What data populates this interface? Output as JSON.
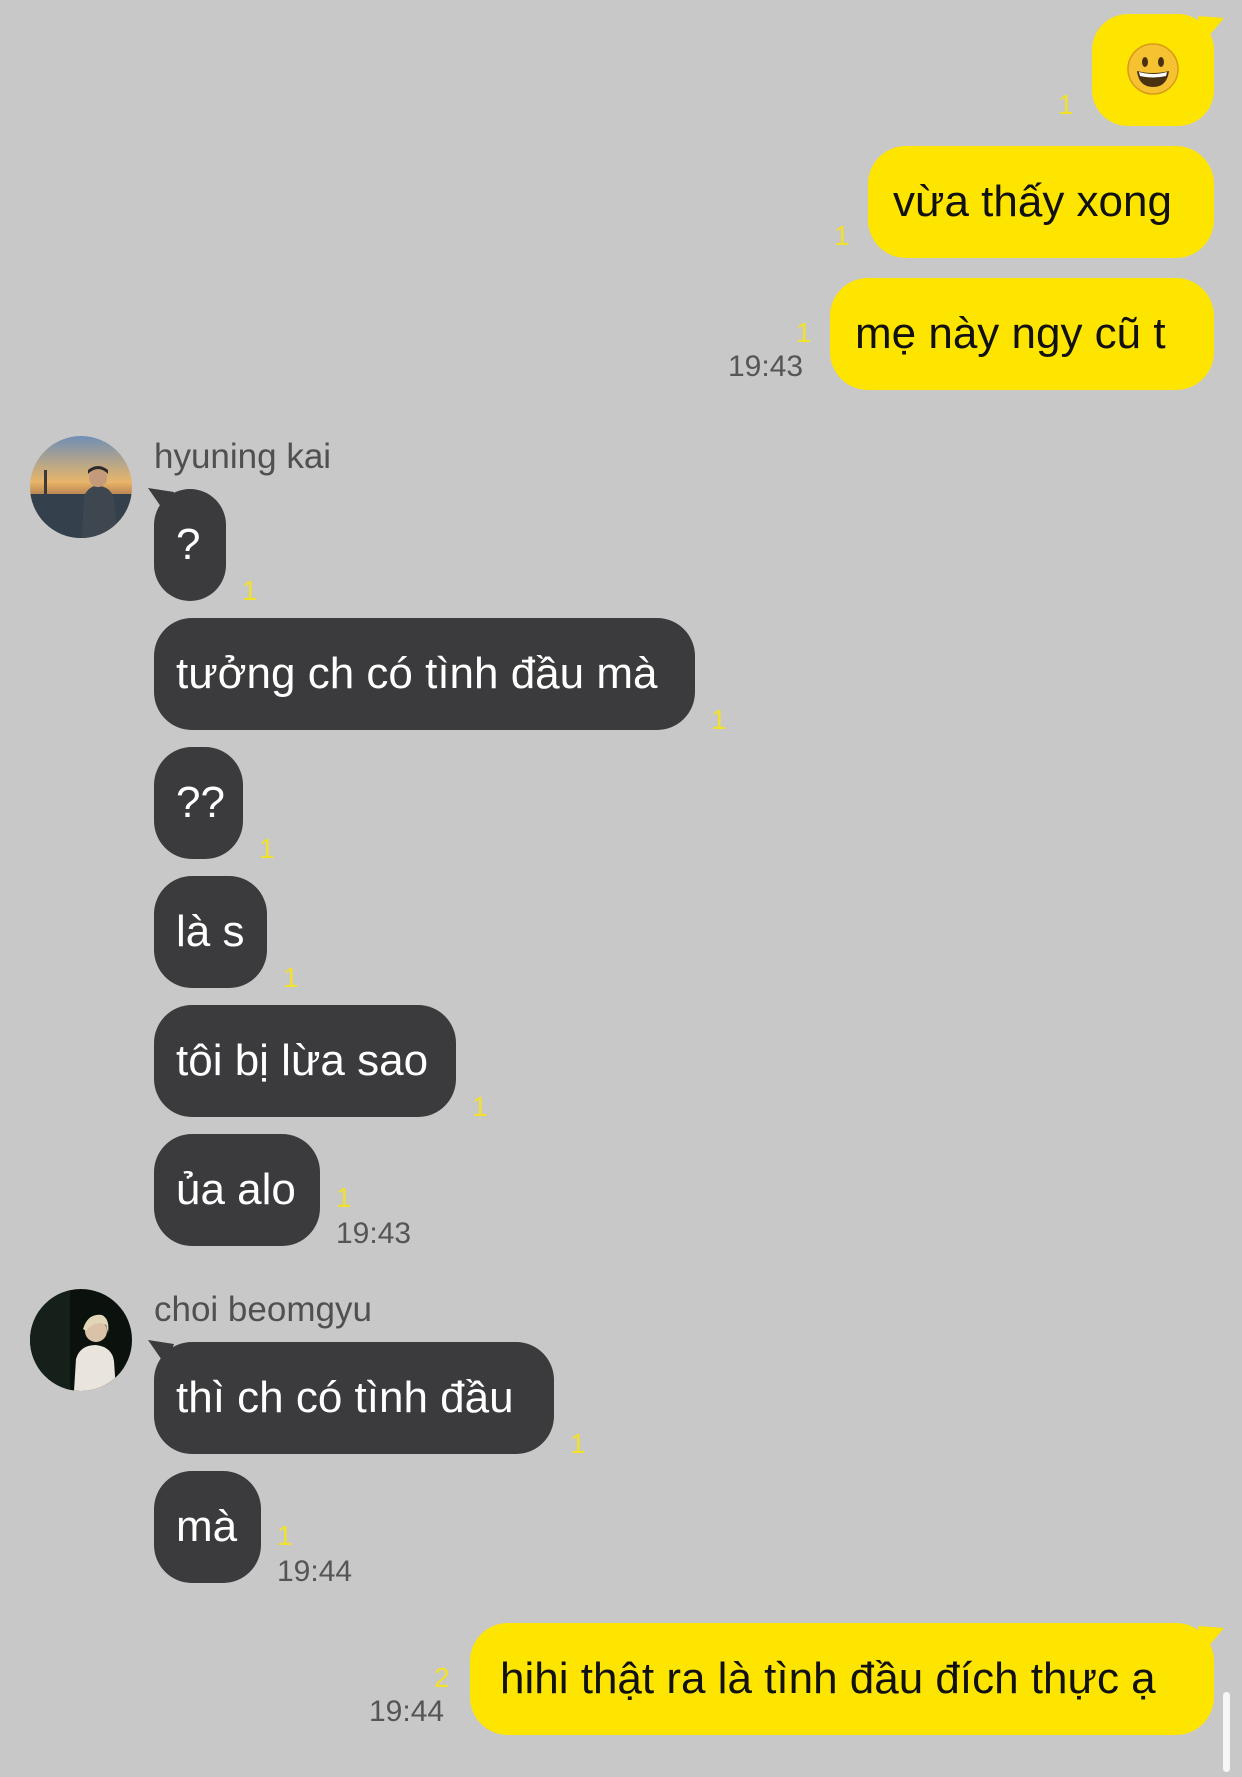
{
  "messages": {
    "m1": {
      "text": "",
      "emoji": "grinning-face",
      "unread": "1"
    },
    "m2": {
      "text": "vừa thấy xong",
      "unread": "1"
    },
    "m3": {
      "text": "mẹ này ngy cũ t",
      "unread": "1",
      "time": "19:43"
    },
    "g1": {
      "sender": "hyuning kai",
      "items": [
        {
          "text": "?",
          "unread": "1"
        },
        {
          "text": "tưởng ch có tình đầu mà",
          "unread": "1"
        },
        {
          "text": "??",
          "unread": "1"
        },
        {
          "text": "là s",
          "unread": "1"
        },
        {
          "text": "tôi bị lừa sao",
          "unread": "1"
        },
        {
          "text": "ủa alo",
          "unread": "1"
        }
      ],
      "time": "19:43"
    },
    "g2": {
      "sender": "choi beomgyu",
      "items": [
        {
          "text": "thì ch có tình đầu",
          "unread": "1"
        },
        {
          "text": "mà",
          "unread": "1"
        }
      ],
      "time": "19:44"
    },
    "m4": {
      "text": "hihi thật ra là tình đầu đích thực ạ",
      "unread": "2",
      "time": "19:44"
    }
  },
  "colors": {
    "background": "#c8c8c8",
    "my_bubble": "#fee500",
    "their_bubble": "#3b3b3d",
    "unread_count": "#f2e12a"
  }
}
